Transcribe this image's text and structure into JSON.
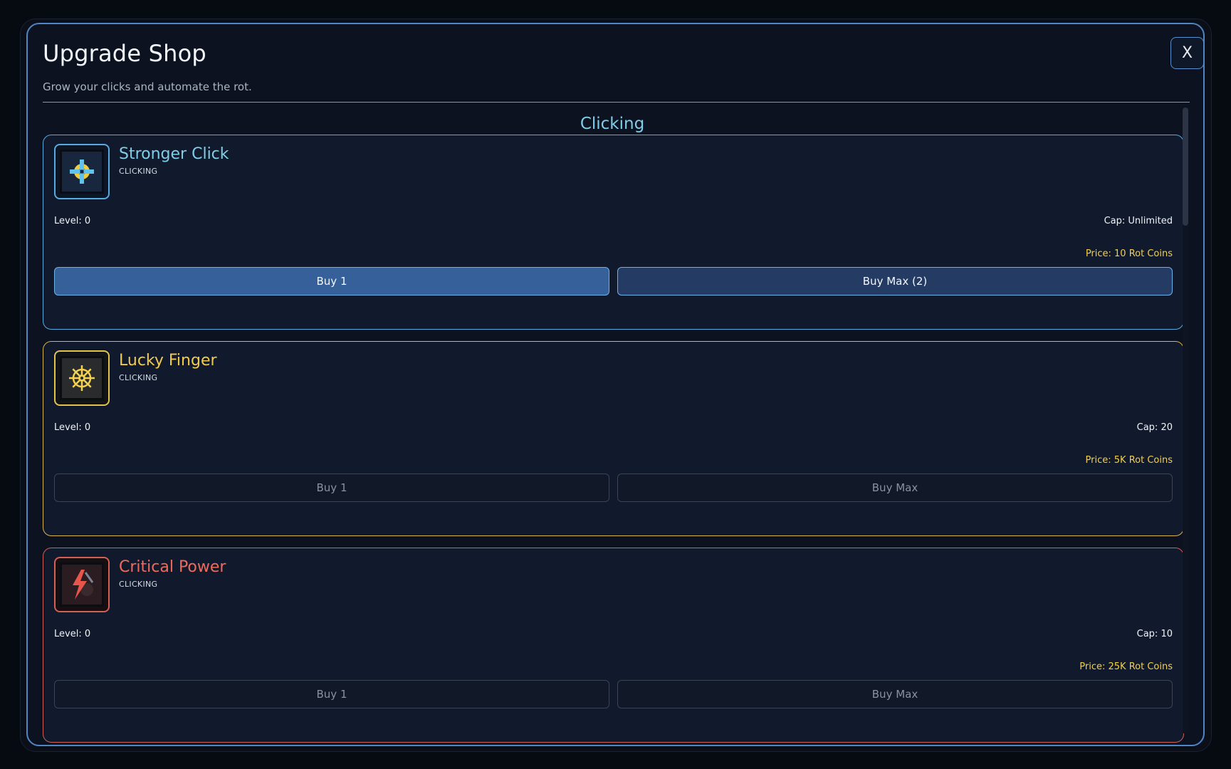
{
  "shop": {
    "title": "Upgrade Shop",
    "subtitle": "Grow your clicks and automate the rot.",
    "close_label": "X"
  },
  "section": {
    "title": "Clicking"
  },
  "cards": [
    {
      "name": "Stronger Click",
      "category": "CLICKING",
      "level": "Level: 0",
      "cap": "Cap: Unlimited",
      "price": "Price: 10 Rot Coins",
      "buy_one_label": "Buy 1",
      "buy_max_label": "Buy Max (2)",
      "icon": "crosshair-icon",
      "accent": "#5aaae2",
      "affordable": true
    },
    {
      "name": "Lucky Finger",
      "category": "CLICKING",
      "level": "Level: 0",
      "cap": "Cap: 20",
      "price": "Price: 5K Rot Coins",
      "buy_one_label": "Buy 1",
      "buy_max_label": "Buy Max",
      "icon": "ship-wheel-icon",
      "accent": "#e2c34e",
      "affordable": false
    },
    {
      "name": "Critical Power",
      "category": "CLICKING",
      "level": "Level: 0",
      "cap": "Cap: 10",
      "price": "Price: 25K Rot Coins",
      "buy_one_label": "Buy 1",
      "buy_max_label": "Buy Max",
      "icon": "lightning-icon",
      "accent": "#d35f55",
      "affordable": false
    }
  ],
  "colors": {
    "background": "#060a11",
    "modal_border": "#4f86c6",
    "section_title": "#7fcde6",
    "price": "#f2cf4e"
  }
}
